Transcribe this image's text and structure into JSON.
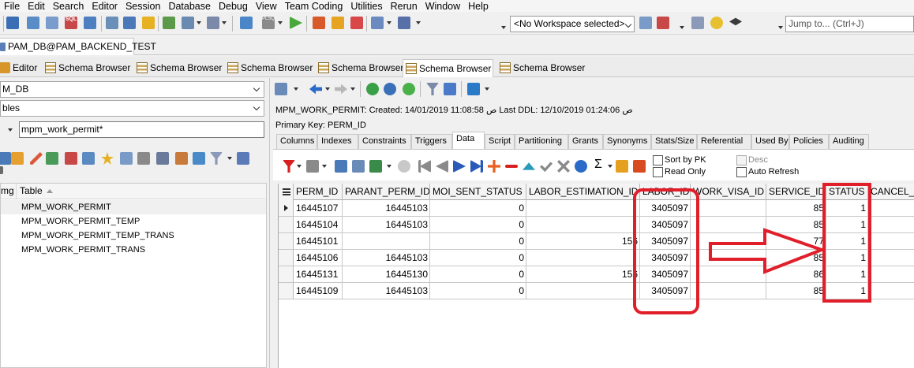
{
  "menu": [
    "File",
    "Edit",
    "Search",
    "Editor",
    "Session",
    "Database",
    "Debug",
    "View",
    "Team Coding",
    "Utilities",
    "Rerun",
    "Window",
    "Help"
  ],
  "toolbar": {
    "workspace_selected": "<No Workspace selected>",
    "jump_placeholder": "Jump to... (Ctrl+J)",
    "sql_badge": "SQL",
    "plsql_badge": "PLSQL"
  },
  "connection_tab": "PAM_DB@PAM_BACKEND_TEST",
  "doc_tabs": [
    {
      "label": "Editor",
      "icon": "editor-icon"
    },
    {
      "label": "Schema Browser",
      "icon": "schema-browser-icon"
    },
    {
      "label": "Schema Browser",
      "icon": "schema-browser-icon"
    },
    {
      "label": "Schema Browser",
      "icon": "schema-browser-icon"
    },
    {
      "label": "Schema Browser",
      "icon": "schema-browser-icon"
    },
    {
      "label": "Schema Browser",
      "icon": "schema-browser-icon",
      "active": true
    },
    {
      "label": "Schema Browser",
      "icon": "schema-browser-icon"
    }
  ],
  "left": {
    "schema": "M_DB",
    "object_type": "bles",
    "filter": "mpm_work_permit*",
    "tree_header": {
      "img": "mg",
      "table": "Table"
    },
    "tables": [
      "MPM_WORK_PERMIT",
      "MPM_WORK_PERMIT_TEMP",
      "MPM_WORK_PERMIT_TEMP_TRANS",
      "MPM_WORK_PERMIT_TRANS"
    ]
  },
  "right": {
    "object_info": "MPM_WORK_PERMIT:  Created: 14/01/2019 11:08:58 ص  Last DDL: 12/10/2019 01:24:06 ص",
    "primary_key": "Primary Key: PERM_ID",
    "tabs": [
      "Columns",
      "Indexes",
      "Constraints",
      "Triggers",
      "Data",
      "Script",
      "Partitioning",
      "Grants",
      "Synonyms",
      "Stats/Size",
      "Referential",
      "Used By",
      "Policies",
      "Auditing"
    ],
    "active_tab": "Data",
    "options": {
      "sort_by_pk": "Sort by PK",
      "read_only": "Read Only",
      "desc": "Desc",
      "auto_refresh": "Auto Refresh"
    },
    "grid": {
      "columns": [
        "PERM_ID",
        "PARANT_PERM_ID",
        "MOI_SENT_STATUS",
        "LABOR_ESTIMATION_ID",
        "LABOR_ID",
        "WORK_VISA_ID",
        "SERVICE_ID",
        "STATUS",
        "CANCEL_D"
      ],
      "rows": [
        [
          "16445107",
          "16445103",
          "0",
          "",
          "3405097",
          "",
          "85",
          "1",
          ""
        ],
        [
          "16445104",
          "16445103",
          "0",
          "",
          "3405097",
          "",
          "85",
          "1",
          ""
        ],
        [
          "16445101",
          "",
          "0",
          "156",
          "3405097",
          "",
          "77",
          "1",
          ""
        ],
        [
          "16445106",
          "16445103",
          "0",
          "",
          "3405097",
          "",
          "85",
          "1",
          ""
        ],
        [
          "16445131",
          "16445130",
          "0",
          "156",
          "3405097",
          "",
          "86",
          "1",
          ""
        ],
        [
          "16445109",
          "16445103",
          "0",
          "",
          "3405097",
          "",
          "85",
          "1",
          ""
        ]
      ]
    }
  },
  "colors": {
    "annotation": "#e01f2a"
  }
}
